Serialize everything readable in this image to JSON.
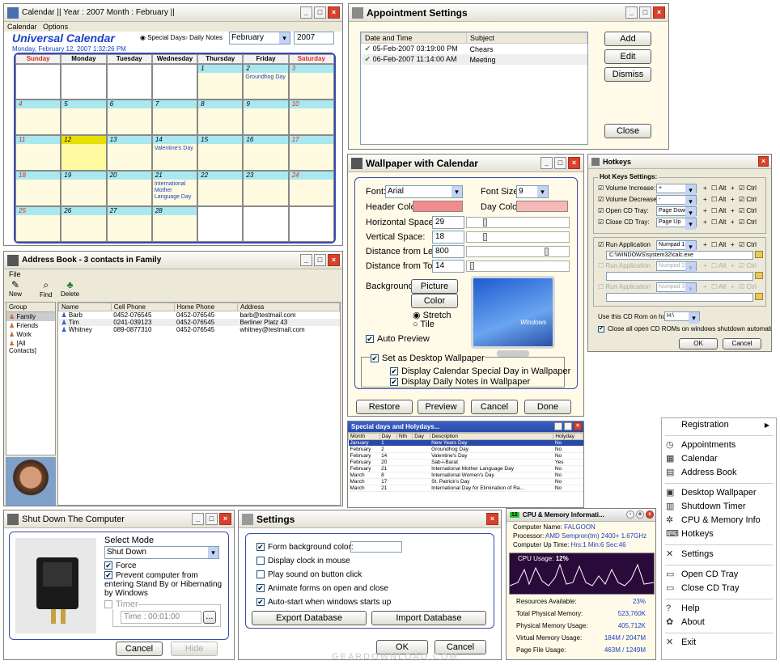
{
  "calendar": {
    "title": "Calendar    ||  Year : 2007  Month : February  ||",
    "menu": [
      "Calendar",
      "Options"
    ],
    "brand": "Universal Calendar",
    "date": "Monday, February 12, 2007   1:32:26 PM",
    "mode_options": [
      "Special Days",
      "Daily Notes"
    ],
    "month": "February",
    "year": "2007",
    "days": [
      "Sunday",
      "Monday",
      "Tuesday",
      "Wednesday",
      "Thursday",
      "Friday",
      "Saturday"
    ],
    "weeks": [
      [
        "",
        "",
        "",
        "",
        "1",
        "2",
        "3"
      ],
      [
        "4",
        "5",
        "6",
        "7",
        "8",
        "9",
        "10"
      ],
      [
        "11",
        "12",
        "13",
        "14",
        "15",
        "16",
        "17"
      ],
      [
        "18",
        "19",
        "20",
        "21",
        "22",
        "23",
        "24"
      ],
      [
        "25",
        "26",
        "27",
        "28",
        "",
        "",
        ""
      ]
    ],
    "events": {
      "2": "Groundhog Day",
      "14": "Valentine's Day",
      "21": "International Mother Language Day"
    }
  },
  "appointments": {
    "title": "Appointment Settings",
    "cols": [
      "Date and Time",
      "Subject"
    ],
    "rows": [
      [
        "05-Feb-2007 03:19:00 PM",
        "Chears"
      ],
      [
        "06-Feb-2007 11:14:00 AM",
        "Meeting"
      ]
    ],
    "buttons": [
      "Add",
      "Edit",
      "Dismiss",
      "Close"
    ]
  },
  "wallpaper": {
    "title": "Wallpaper with Calendar",
    "font_label": "Font:",
    "font": "Arial",
    "size_label": "Font Size:",
    "size": "9",
    "header_color": "Header Color:",
    "day_color": "Day Color:",
    "hspace": "Horizontal Space:",
    "hspace_v": "29",
    "vspace": "Vertical Space:",
    "vspace_v": "18",
    "left": "Distance from Left:",
    "left_v": "800",
    "top": "Distance from Top:",
    "top_v": "14",
    "bg": "Background:",
    "picture": "Picture",
    "color": "Color",
    "stretch": "Stretch",
    "tile": "Tile",
    "auto_preview": "Auto Preview",
    "set_desktop": "Set as Desktop Wallpaper",
    "disp_special": "Display Calendar Special Day in Wallpaper",
    "disp_notes": "Display Daily Notes in Wallpaper",
    "buttons": [
      "Restore Default",
      "Preview",
      "Cancel",
      "Done"
    ],
    "windows_logo": "Windows"
  },
  "hotkeys": {
    "title": "Hotkeys",
    "section": "Hot Keys Settings:",
    "rows": [
      [
        "Volume Increase:",
        "+"
      ],
      [
        "Volume Decrease:",
        "-"
      ],
      [
        "Open CD Tray:",
        "Page Down"
      ],
      [
        "Close CD Tray:",
        "Page Up"
      ]
    ],
    "mods": [
      "+",
      "Alt",
      "+",
      "Ctrl"
    ],
    "run_rows": [
      [
        "Run Application",
        "Numpad 1",
        "C:\\WINDOWS\\system32\\calc.exe"
      ],
      [
        "Run Application",
        "Numpad 2",
        ""
      ],
      [
        "Run Application",
        "Numpad 3",
        ""
      ]
    ],
    "cdrom_label": "Use this CD Rom on hotkey:",
    "cdrom": "H:\\",
    "close_all": "Close all open CD ROMs on windows shutdown automatically",
    "ok": "OK",
    "cancel": "Cancel"
  },
  "address": {
    "title": "Address Book - 3 contacts in Family",
    "menu": "File",
    "tools": [
      "New",
      "Find",
      "Delete"
    ],
    "group_header": "Group",
    "groups": [
      "Family",
      "Friends",
      "Work",
      "[All Contacts]"
    ],
    "cols": [
      "Name",
      "Cell Phone",
      "Home Phone",
      "Address"
    ],
    "rows": [
      [
        "Barb",
        "0452-076545",
        "0452-076545",
        "barb@testmail.com"
      ],
      [
        "Tim",
        "0241-039123",
        "0452-076545",
        "Berliner Platz 43"
      ],
      [
        "Whitney",
        "089-0877310",
        "0452-076545",
        "whitney@testmail.com"
      ]
    ]
  },
  "special": {
    "title": "Special days and Holydays...",
    "cols": [
      "Month",
      "Day",
      "Nth",
      "Day",
      "Description",
      "Holyday"
    ],
    "rows": [
      [
        "January",
        "1",
        "",
        "",
        "New Years Day",
        "No"
      ],
      [
        "February",
        "2",
        "",
        "",
        "Groundhog Day",
        "No"
      ],
      [
        "February",
        "14",
        "",
        "",
        "Valentine's Day",
        "No"
      ],
      [
        "February",
        "20",
        "",
        "",
        "Sab-i-Barat",
        "Yes"
      ],
      [
        "February",
        "21",
        "",
        "",
        "International Mother Language Day",
        "No"
      ],
      [
        "March",
        "8",
        "",
        "",
        "International Women's Day",
        "No"
      ],
      [
        "March",
        "17",
        "",
        "",
        "St. Patrick's Day",
        "No"
      ],
      [
        "March",
        "21",
        "",
        "",
        "International Day for Elimination of Ra...",
        "No"
      ]
    ]
  },
  "shutdown": {
    "title": "Shut Down The Computer",
    "mode_label": "Select Mode",
    "mode": "Shut Down",
    "force": "Force",
    "prevent": "Prevent computer from entering Stand By or Hibernating by Windows",
    "timer": "Timer",
    "time": "Time : 00:01:00",
    "cancel": "Cancel",
    "hide": "Hide"
  },
  "settings": {
    "title": "Settings",
    "opts": [
      "Form background color:",
      "Display clock in mouse",
      "Play sound on button click",
      "Animate forms on open and close",
      "Auto-start when windows starts up"
    ],
    "checked": [
      true,
      false,
      false,
      true,
      true
    ],
    "export": "Export Database",
    "import": "Import Database",
    "ok": "OK",
    "cancel": "Cancel"
  },
  "cpu": {
    "title": "CPU & Memory Informati...",
    "badge": "12",
    "name_l": "Computer Name:",
    "name": "FALGOON",
    "proc_l": "Processor:",
    "proc": "AMD Sempron(tm) 2400+ 1.67GHz",
    "up_l": "Computer Up Time:",
    "up": "Hrs:1 Min:6 Sec:46",
    "usage_l": "CPU Usage:",
    "usage": "12%",
    "stats": [
      [
        "Resources Available:",
        "23%"
      ],
      [
        "Total Physical Memory:",
        "523,760K"
      ],
      [
        "Physical Memory Usage:",
        "405,712K"
      ],
      [
        "Virtual Memory Usage:",
        "184M / 2047M"
      ],
      [
        "Page File Usage:",
        "463M / 1249M"
      ]
    ]
  },
  "menu": {
    "items": [
      "Registration",
      "Appointments",
      "Calendar",
      "Address Book",
      "Desktop Wallpaper",
      "Shutdown Timer",
      "CPU & Memory Info",
      "Hotkeys",
      "Settings",
      "Open CD Tray",
      "Close CD Tray",
      "Help",
      "About",
      "Exit"
    ]
  },
  "watermark": "GEARDOWNLOAD.COM"
}
